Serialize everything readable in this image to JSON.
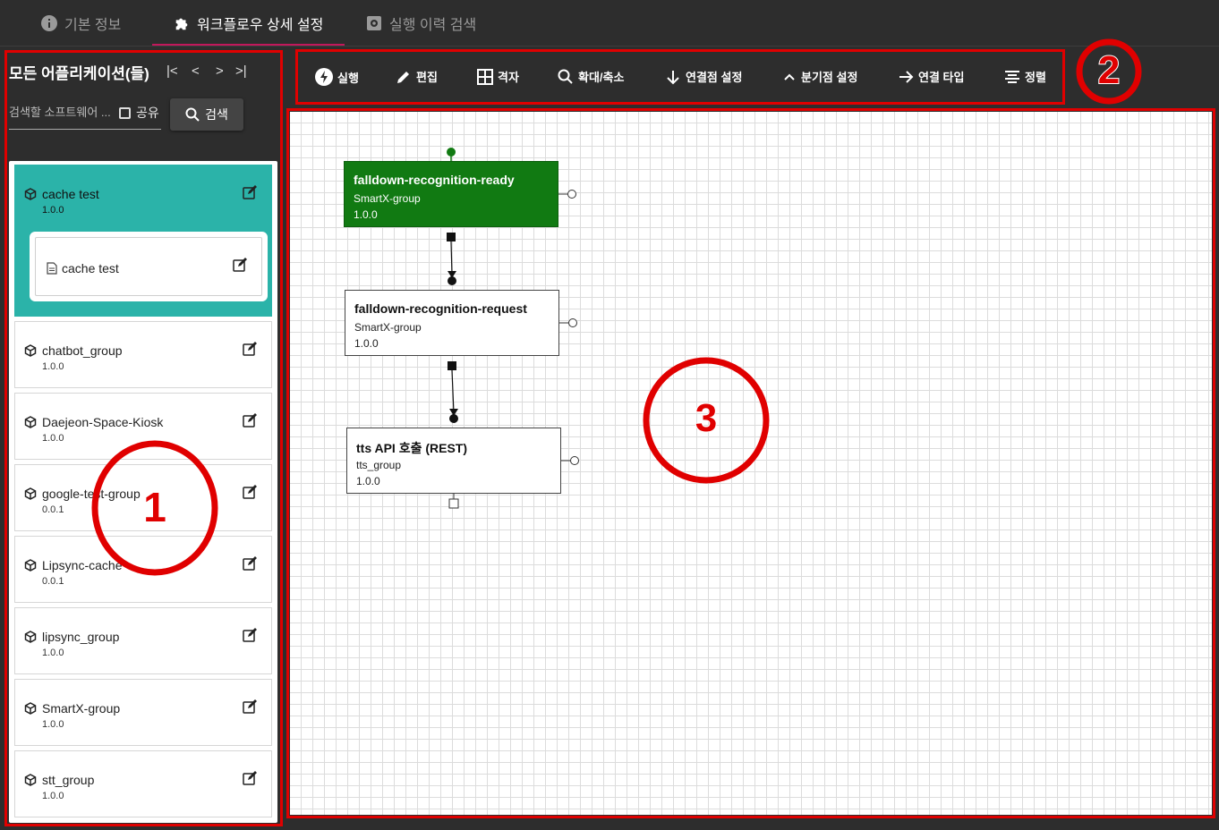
{
  "tabs": [
    {
      "label": "기본 정보",
      "icon": "info-icon",
      "active": false
    },
    {
      "label": "워크플로우 상세 설정",
      "icon": "puzzle-icon",
      "active": true
    },
    {
      "label": "실행 이력 검색",
      "icon": "settings-box-icon",
      "active": false
    }
  ],
  "sidebar": {
    "title": "모든 어플리케이션(들)",
    "pager": {
      "first": "|<",
      "prev": "<",
      "next": ">",
      "last": ">|"
    },
    "search_placeholder": "검색할 소프트웨어 ...",
    "share_label": "공유",
    "search_button": "검색",
    "apps": [
      {
        "name": "cache test",
        "version": "1.0.0",
        "selected": true,
        "children": [
          {
            "name": "cache test"
          }
        ]
      },
      {
        "name": "chatbot_group",
        "version": "1.0.0"
      },
      {
        "name": "Daejeon-Space-Kiosk",
        "version": "1.0.0"
      },
      {
        "name": "google-test-group",
        "version": "0.0.1"
      },
      {
        "name": "Lipsync-cache",
        "version": "0.0.1"
      },
      {
        "name": "lipsync_group",
        "version": "1.0.0"
      },
      {
        "name": "SmartX-group",
        "version": "1.0.0"
      },
      {
        "name": "stt_group",
        "version": "1.0.0"
      }
    ]
  },
  "toolbar": {
    "run": "실행",
    "edit": "편집",
    "grid": "격자",
    "zoom": "확대/축소",
    "connect_point": "연결점 설정",
    "branch_point": "분기점 설정",
    "connect_type": "연결 타입",
    "align": "정렬"
  },
  "workflow": {
    "nodes": [
      {
        "title": "falldown-recognition-ready",
        "group": "SmartX-group",
        "version": "1.0.0",
        "start": true
      },
      {
        "title": "falldown-recognition-request",
        "group": "SmartX-group",
        "version": "1.0.0"
      },
      {
        "title": "tts API 호출 (REST)",
        "group": "tts_group",
        "version": "1.0.0"
      }
    ]
  },
  "annotations": {
    "one": "1",
    "two": "2",
    "three": "3"
  },
  "colors": {
    "accent_tab": "#c2185b",
    "selected_card": "#2bb3a9",
    "start_node": "#117a12",
    "annotation": "#e00000"
  }
}
